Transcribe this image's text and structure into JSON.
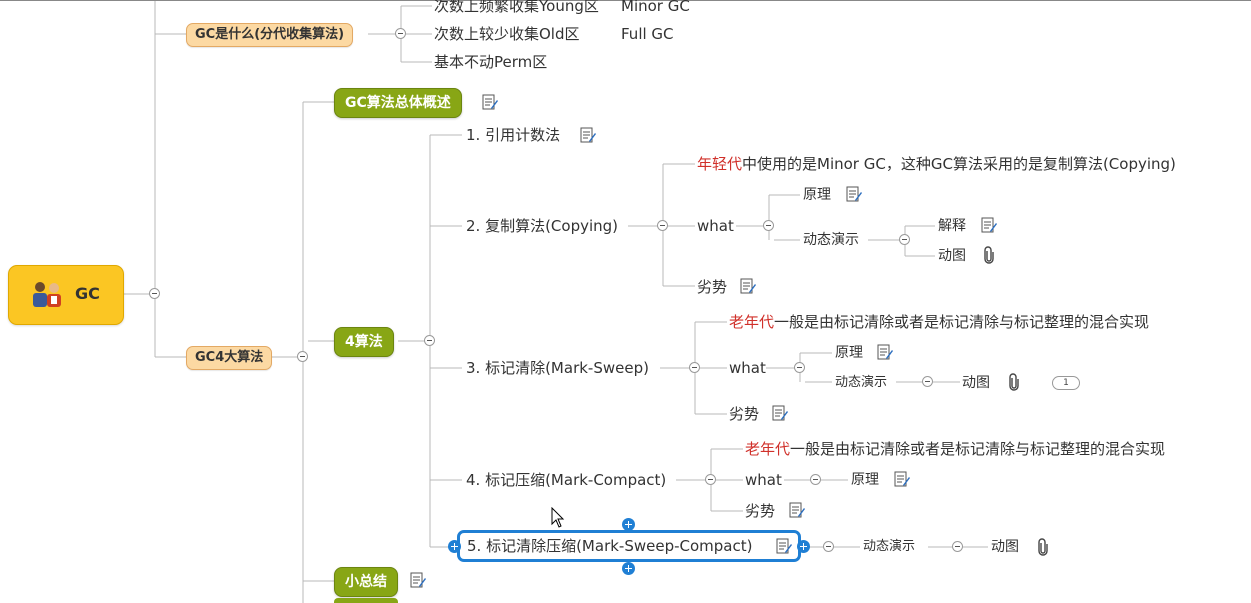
{
  "root": {
    "label": "GC"
  },
  "gc_what": {
    "label": "GC是什么(分代收集算法)",
    "items": [
      "次数上频繁收集Young区",
      "次数上较少收集Old区",
      "基本不动Perm区"
    ],
    "right": [
      "Minor GC",
      "Full GC"
    ]
  },
  "gc4": {
    "label": "GC4大算法"
  },
  "overview": {
    "label": "GC算法总体概述"
  },
  "four": {
    "label": "4算法"
  },
  "small_summary": {
    "label": "小总结"
  },
  "algo": {
    "a1": "1. 引用计数法",
    "a2": "2. 复制算法(Copying)",
    "a3": "3. 标记清除(Mark-Sweep)",
    "a4": "4. 标记压缩(Mark-Compact)",
    "a5": "5. 标记清除压缩(Mark-Sweep-Compact)"
  },
  "copying": {
    "desc_red": "年轻代",
    "desc_rest": "中使用的是Minor GC，这种GC算法采用的是复制算法(Copying)",
    "what": "what",
    "principle": "原理",
    "demo": "动态演示",
    "explain": "解释",
    "gif": "动图",
    "weakness": "劣势"
  },
  "marksweep": {
    "desc_red": "老年代",
    "desc_rest": "一般是由标记清除或者是标记清除与标记整理的混合实现",
    "what": "what",
    "principle": "原理",
    "demo": "动态演示",
    "gif": "动图",
    "badge": "1",
    "weakness": "劣势"
  },
  "markcompact": {
    "desc_red": "老年代",
    "desc_rest": "一般是由标记清除或者是标记清除与标记整理的混合实现",
    "what": "what",
    "principle": "原理",
    "weakness": "劣势"
  },
  "msc": {
    "demo": "动态演示",
    "gif": "动图"
  },
  "colors": {
    "root": "#fbc623",
    "green": "#88a615",
    "tag": "#fcd9a3",
    "select": "#1f7fd4",
    "red": "#d0302a"
  }
}
